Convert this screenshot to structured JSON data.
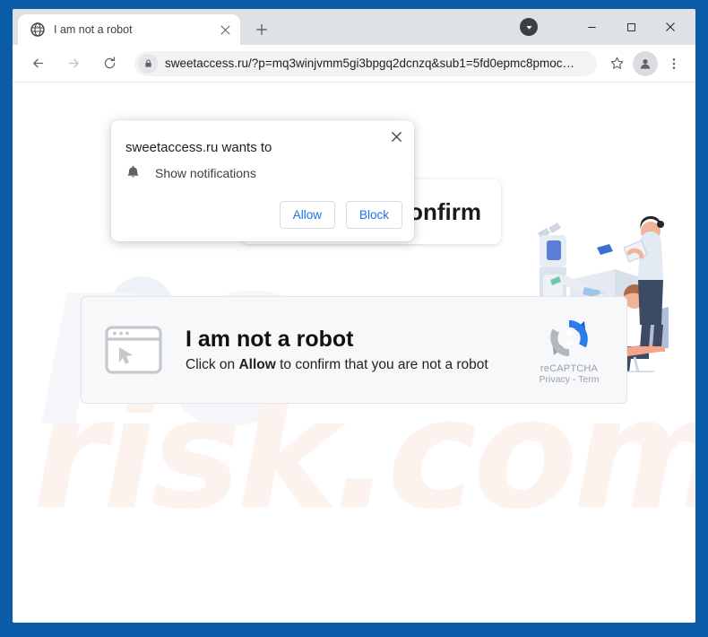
{
  "browser": {
    "tab": {
      "title": "I am not a robot",
      "favicon": "globe-icon",
      "close_label": "✕"
    },
    "new_tab_label": "+",
    "window_controls": {
      "minimize": "–",
      "maximize": "□",
      "close": "✕"
    },
    "toolbar": {
      "back_label": "←",
      "forward_label": "→",
      "reload_label": "⟳",
      "lock_icon": "lock-icon",
      "url_host": "sweetaccess.ru",
      "url_path": "/?p=mq3winjvmm5gi3bpgq2dcnzq&sub1=5fd0epmc8pmoc…",
      "bookmark_icon": "star-icon",
      "profile_icon": "person-icon",
      "menu_icon": "three-dots-icon"
    },
    "download_icon": "download-circle-icon"
  },
  "permission_popup": {
    "title": "sweetaccess.ru wants to",
    "request_icon": "bell-icon",
    "request_label": "Show notifications",
    "allow_label": "Allow",
    "block_label": "Block",
    "close_label": "✕"
  },
  "page": {
    "confirm_card_text": "onfirm",
    "robot": {
      "icon": "browser-window-cursor-icon",
      "title": "I am not a robot",
      "subtitle_prefix": "Click on ",
      "subtitle_bold": "Allow",
      "subtitle_suffix": " to confirm that you are not a robot"
    },
    "recaptcha": {
      "logo": "recaptcha-icon",
      "name": "reCAPTCHA",
      "links": "Privacy - Term"
    },
    "illustration": "robot-and-office-workers-illustration",
    "watermark_top": "PC",
    "watermark_bottom": "risk.com"
  },
  "colors": {
    "desktop": "#0b5ca8",
    "tabstrip": "#dee1e6",
    "accent_blue": "#1a73e8",
    "recaptcha_blue": "#1c5ed6",
    "recaptcha_gray": "#9aa0a6"
  }
}
